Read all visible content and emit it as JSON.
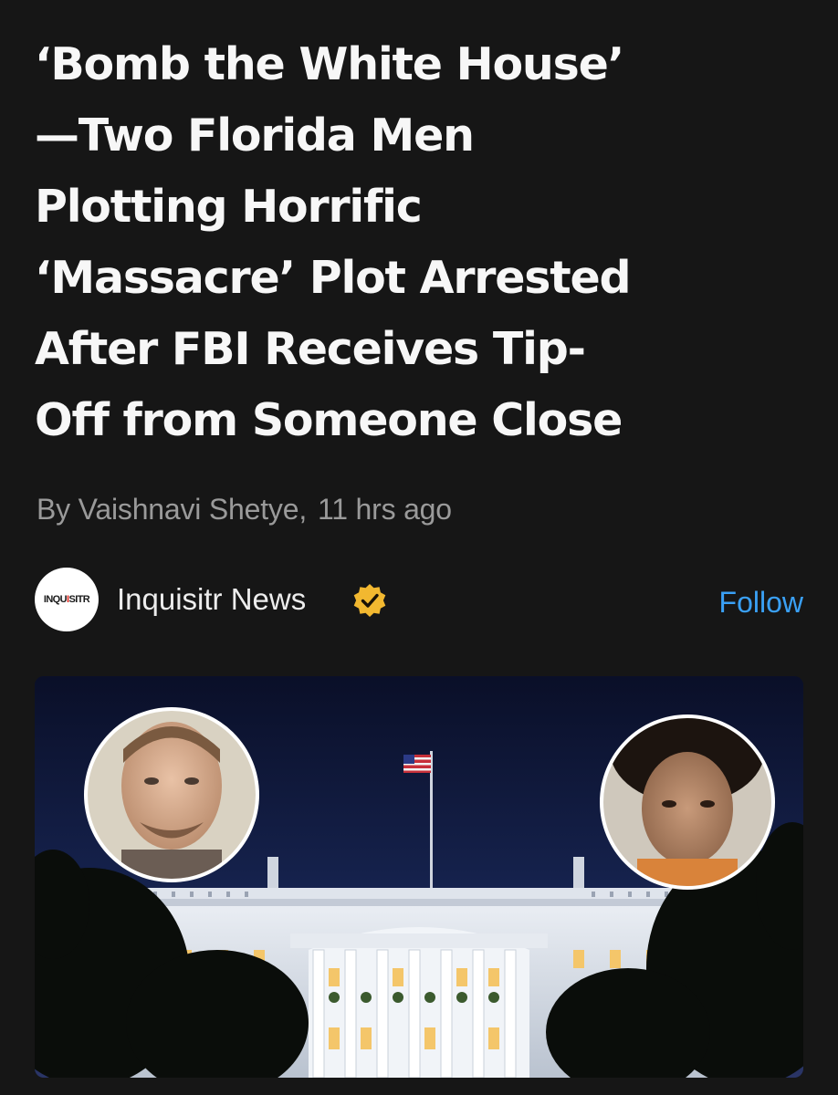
{
  "article": {
    "headline_lines": [
      "‘Bomb the White House’",
      "—Two Florida Men",
      "Plotting Horrific",
      "‘Massacre’ Plot Arrested",
      "After FBI Receives Tip-",
      "Off from Someone Close"
    ],
    "byline_author": "By Vaishnavi Shetye,",
    "byline_time": "11 hrs ago"
  },
  "publisher": {
    "logo_text_part1": "INQU",
    "logo_text_accent": "I",
    "logo_text_part2": "SITR",
    "name": "Inquisitr News",
    "verified_icon": "verified-badge-icon",
    "follow_label": "Follow"
  },
  "colors": {
    "background": "#161616",
    "headline": "#f7f7f7",
    "byline": "#9a9a9a",
    "follow_accent": "#3aa0f5",
    "verified_badge": "#f2b830",
    "logo_accent": "#e2231a"
  }
}
